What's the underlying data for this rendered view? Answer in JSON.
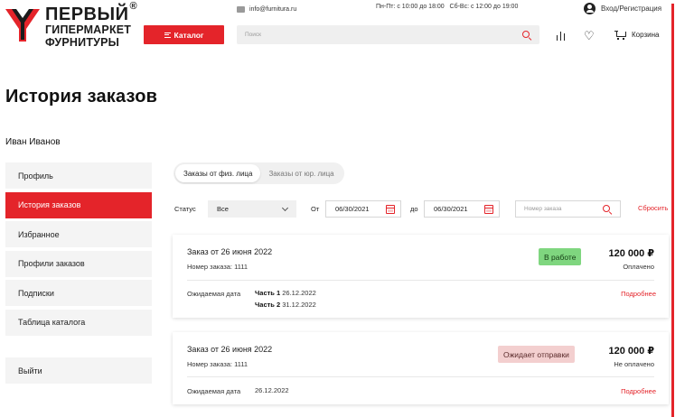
{
  "header": {
    "logo": {
      "line1": "ПЕРВЫЙ",
      "reg": "®",
      "line2": "ГИПЕРМАРКЕТ",
      "line3": "ФУРНИТУРЫ"
    },
    "email": "info@furnitura.ru",
    "hours": "Пн-Пт: с 10:00 до 18:00   Сб-Вс: с 12:00 до 19:00",
    "login_label": "Вход/Регистрация",
    "catalog_label": "Каталог",
    "search_placeholder": "Поиск",
    "cart_label": "Корзина"
  },
  "page": {
    "title": "История заказов",
    "user_name": "Иван Иванов"
  },
  "sidebar": {
    "items": [
      {
        "label": "Профиль",
        "active": false
      },
      {
        "label": "История заказов",
        "active": true
      },
      {
        "label": "Избранное",
        "active": false
      },
      {
        "label": "Профили заказов",
        "active": false
      },
      {
        "label": "Подписки",
        "active": false
      },
      {
        "label": "Таблица каталога",
        "active": false
      }
    ],
    "logout_label": "Выйти"
  },
  "tabs": [
    {
      "label": "Заказы от физ. лица",
      "active": true
    },
    {
      "label": "Заказы от юр. лица",
      "active": false
    }
  ],
  "filters": {
    "status_label": "Статус",
    "status_value": "Все",
    "from_label": "От",
    "from_date": "06/30/2021",
    "to_label": "до",
    "to_date": "06/30/2021",
    "order_number_placeholder": "Номер заказа",
    "reset_label": "Сбросить"
  },
  "orders": [
    {
      "title": "Заказ от 26 июня 2022",
      "number": "Номер заказа: 1111",
      "status": "В работе",
      "status_color": "#7fd67f",
      "price": "120 000 ₽",
      "payment": "Оплачено",
      "expected_label": "Ожидаемая дата",
      "parts": [
        {
          "name": "Часть 1",
          "date": "26.12.2022"
        },
        {
          "name": "Часть 2",
          "date": "31.12.2022"
        }
      ],
      "more_label": "Подробнее"
    },
    {
      "title": "Заказ от 26 июня 2022",
      "number": "Номер заказа: 1111",
      "status": "Ожидает отправки",
      "status_color": "#f3cfcf",
      "price": "120 000 ₽",
      "payment": "Не оплачено",
      "expected_label": "Ожидаемая дата",
      "expected_date": "26.12.2022",
      "more_label": "Подробнее"
    }
  ],
  "colors": {
    "accent": "#e4242a",
    "sidebar_bg": "#f4f4f4"
  }
}
